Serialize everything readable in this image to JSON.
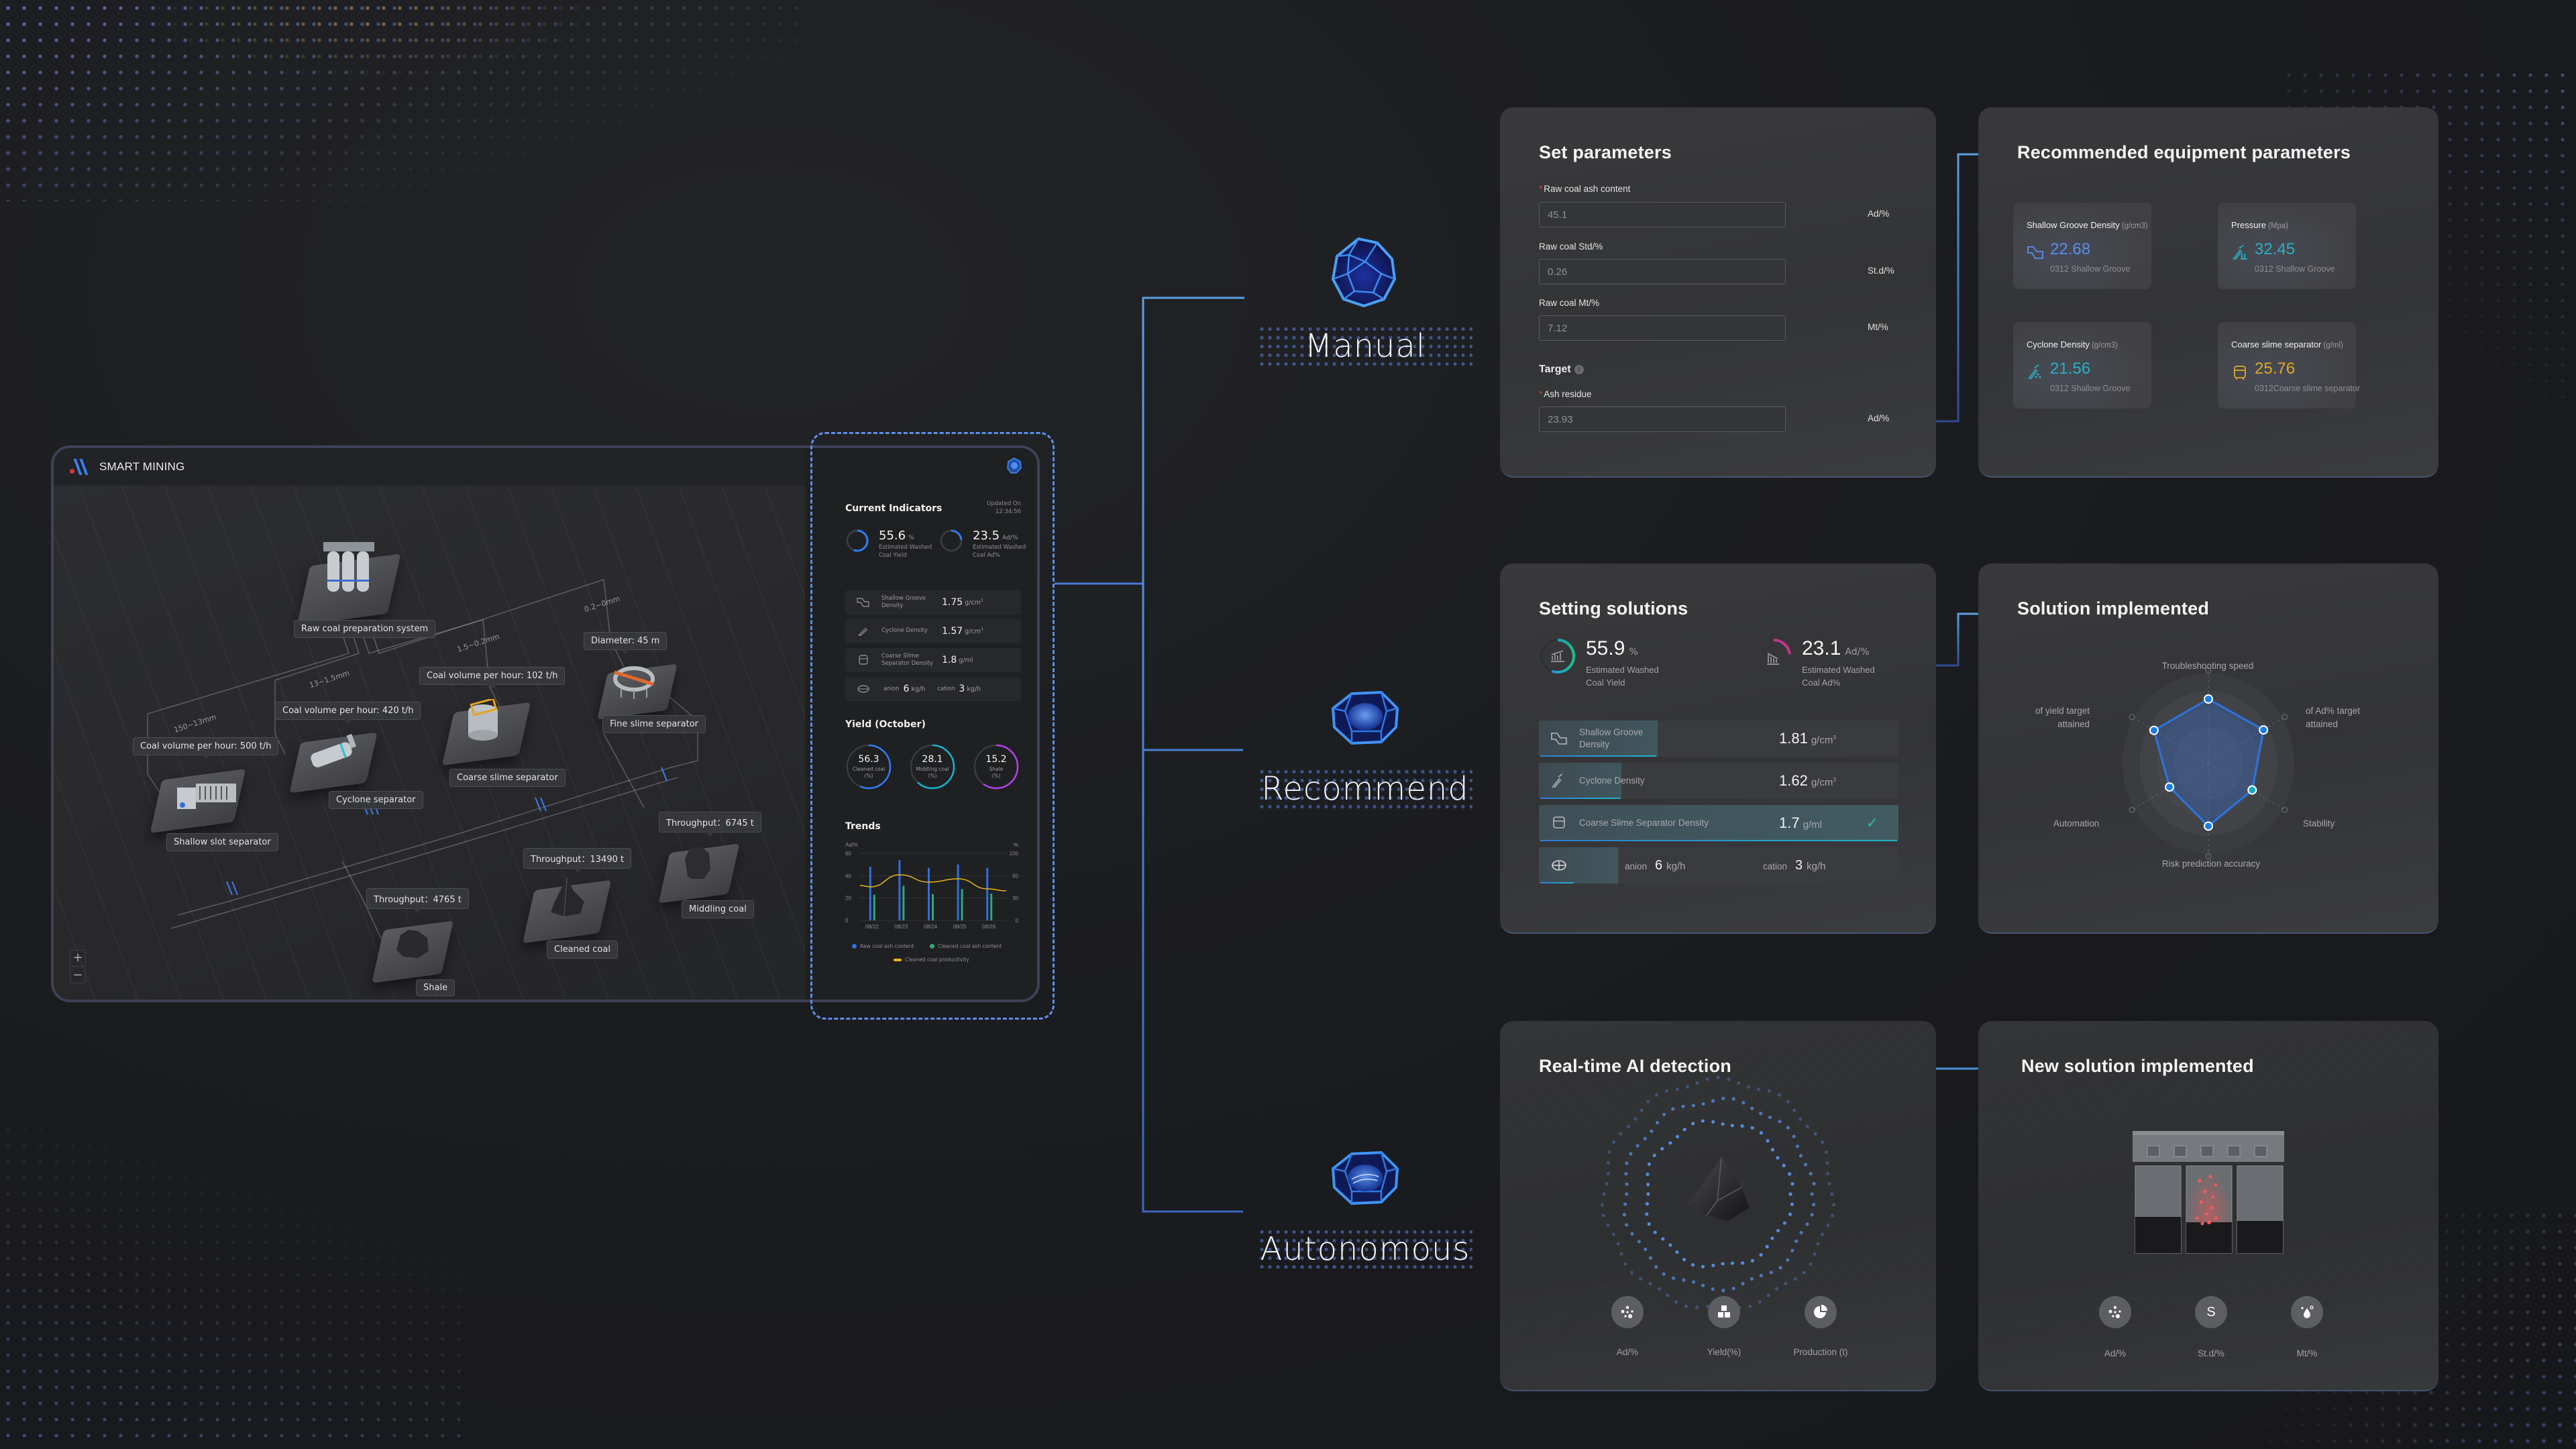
{
  "dashboard": {
    "brand": "SMART MINING",
    "map": {
      "size_ranges": [
        "150~13mm",
        "13~1.5mm",
        "1.5~0.2mm",
        "0.2~0mm"
      ],
      "equipment": [
        {
          "name": "Raw coal preparation system",
          "callout": ""
        },
        {
          "name": "Shallow slot separator",
          "callout": "Coal volume per hour: 500 t/h"
        },
        {
          "name": "Cyclone separator",
          "callout": "Coal volume per hour: 420 t/h"
        },
        {
          "name": "Coarse slime separator",
          "callout": "Coal volume per hour: 102 t/h"
        },
        {
          "name": "Fine slime separator",
          "callout": "Diameter: 45 m"
        },
        {
          "name": "Shale",
          "callout": "Throughput：4765 t"
        },
        {
          "name": "Cleaned coal",
          "callout": "Throughput：13490 t"
        },
        {
          "name": "Middling coal",
          "callout": "Throughput：6745 t"
        }
      ],
      "zoom_in": "+",
      "zoom_out": "−"
    },
    "current": {
      "title": "Current Indicators",
      "updated_label": "Updated On",
      "updated_time": "12:34:56",
      "yield": {
        "value": "55.6",
        "unit": "%",
        "desc1": "Estimated Washed",
        "desc2": "Coal Yield",
        "progress": 0.556
      },
      "ash": {
        "value": "23.5",
        "unit": "Ad/%",
        "desc1": "Estimated Washed",
        "desc2": "Coal Ad%",
        "progress": 0.235
      },
      "rows": [
        {
          "icon": "shallow-groove-icon",
          "name": "Shallow Groove Density",
          "value": "1.75",
          "unit": "g/cm",
          "sup": "3"
        },
        {
          "icon": "cyclone-icon",
          "name": "Cyclone Density",
          "value": "1.57",
          "unit": "g/cm",
          "sup": "3"
        },
        {
          "icon": "coarse-slime-icon",
          "name": "Coarse Slime Separator Density",
          "value": "1.8",
          "unit": "g/ml",
          "sup": ""
        },
        {
          "icon": "ion-dosing-icon",
          "anion_label": "anion",
          "anion_value": "6",
          "anion_unit": "kg/h",
          "cation_label": "cation",
          "cation_value": "3",
          "cation_unit": "kg/h"
        }
      ]
    },
    "yield_month": {
      "title": "Yield (October)",
      "gauges": [
        {
          "value": "56.3",
          "label1": "Cleaned coal",
          "label2": "(%)",
          "fraction": 0.563,
          "color": "#2f7cf6"
        },
        {
          "value": "28.1",
          "label1": "Middling coal",
          "label2": "(%)",
          "fraction": 0.62,
          "color": "#17b3c9"
        },
        {
          "value": "15.2",
          "label1": "Shale",
          "label2": "(%)",
          "fraction": 0.6,
          "color": "#b43ff0"
        }
      ]
    },
    "trends": {
      "title": "Trends"
    }
  },
  "chart_data": {
    "type": "bar",
    "title": "Trends",
    "categories": [
      "08/22",
      "08/23",
      "08/24",
      "08/25",
      "08/26"
    ],
    "ylabel_left": "Ad/%",
    "ylabel_right": "%",
    "ylim_left": [
      0,
      60
    ],
    "ylim_right": [
      0,
      100
    ],
    "yticks_left": [
      0,
      20,
      40,
      60
    ],
    "yticks_right": [
      0,
      30,
      60,
      100
    ],
    "grid": true,
    "legend_position": "bottom",
    "series": [
      {
        "name": "Raw coal ash content",
        "type": "bar",
        "axis": "left",
        "color": "#2f6fe0",
        "values": [
          48,
          54,
          47,
          50,
          47
        ]
      },
      {
        "name": "Cleaned coal ash content",
        "type": "bar",
        "axis": "left",
        "color": "#2fa877",
        "values": [
          23,
          31,
          23.5,
          28,
          24
        ]
      },
      {
        "name": "Cleaned coal productivity",
        "type": "line",
        "axis": "right",
        "color": "#e8b416",
        "values": [
          50,
          68,
          57,
          62,
          47
        ]
      }
    ]
  },
  "modes": [
    {
      "label": "Manual"
    },
    {
      "label": "Recommend"
    },
    {
      "label": "Autonomous"
    }
  ],
  "set_parameters": {
    "title": "Set parameters",
    "fields": [
      {
        "label": "Raw coal ash content",
        "required": true,
        "value": "45.1",
        "unit": "Ad/%"
      },
      {
        "label": "Raw coal Std/%",
        "required": false,
        "value": "0.26",
        "unit": "St.d/%"
      },
      {
        "label": "Raw coal Mt/%",
        "required": false,
        "value": "7.12",
        "unit": "Mt/%"
      }
    ],
    "target_label": "Target",
    "target_field": {
      "label": "Ash residue",
      "required": true,
      "value": "23.93",
      "unit": "Ad/%"
    }
  },
  "recommended": {
    "title": "Recommended equipment parameters",
    "tiles": [
      {
        "title": "Shallow Groove Density",
        "unit": "(g/cm3)",
        "value": "22.68",
        "sub": "0312 Shallow Groove",
        "color": "#5b8cf0",
        "icon": "shallow-groove-icon"
      },
      {
        "title": "Pressure",
        "unit": "(Mpa)",
        "value": "32.45",
        "sub": "0312 Shallow Groove",
        "color": "#2ab0c6",
        "icon": "pressure-icon"
      },
      {
        "title": "Cyclone Density",
        "unit": "(g/cm3)",
        "value": "21.56",
        "sub": "0312 Shallow Groove",
        "color": "#2ab0c6",
        "icon": "cyclone-icon"
      },
      {
        "title": "Coarse slime separator",
        "unit": "(g/ml)",
        "value": "25.76",
        "sub": "0312Coarse slime separator",
        "color": "#e0a625",
        "icon": "coarse-slime-icon"
      }
    ]
  },
  "setting_solutions": {
    "title": "Setting solutions",
    "yield": {
      "value": "55.9",
      "unit": "%",
      "desc1": "Estimated Washed",
      "desc2": "Coal Yield",
      "progress": 0.559
    },
    "ash": {
      "value": "23.1",
      "unit": "Ad/%",
      "desc1": "Estimated Washed",
      "desc2": "Coal Ad%",
      "progress": 0.231
    },
    "rows": [
      {
        "name1": "Shallow Groove",
        "name2": "Density",
        "value": "1.81",
        "unit": "g/cm",
        "sup": "3",
        "fill": 0.33,
        "active": false
      },
      {
        "name1": "Cyclone Density",
        "name2": "",
        "value": "1.62",
        "unit": "g/cm",
        "sup": "3",
        "fill": 0.23,
        "active": false
      },
      {
        "name1": "Coarse Slime  Separator Density",
        "name2": "",
        "value": "1.7",
        "unit": "g/ml",
        "sup": "",
        "fill": 1.0,
        "active": true
      },
      {
        "anion_label": "anion",
        "anion_value": "6",
        "anion_unit": "kg/h",
        "cation_label": "cation",
        "cation_value": "3",
        "cation_unit": "kg/h",
        "fill": 0.1
      }
    ]
  },
  "solution_implemented": {
    "title": "Solution implemented",
    "radar": {
      "axes": [
        "Troubleshooting speed",
        "of Ad% target attained",
        "Stability",
        "Risk prediction accuracy",
        "Automation",
        "of yield target attained"
      ],
      "values": [
        0.75,
        0.78,
        0.62,
        0.73,
        0.55,
        0.77
      ]
    }
  },
  "ai_detection": {
    "title": "Real-time AI detection",
    "metrics": [
      {
        "label": "Ad/%",
        "icon": "particles-icon"
      },
      {
        "label": "Yield(%)",
        "icon": "cubes-icon"
      },
      {
        "label": "Production (t)",
        "icon": "pie-chart-icon"
      }
    ]
  },
  "new_solution": {
    "title": "New solution implemented",
    "metrics": [
      {
        "label": "Ad/%",
        "icon": "particles-icon"
      },
      {
        "label": "St.d/%",
        "icon": "sulfur-icon",
        "glyph": "S"
      },
      {
        "label": "Mt/%",
        "icon": "moisture-icon"
      }
    ]
  }
}
